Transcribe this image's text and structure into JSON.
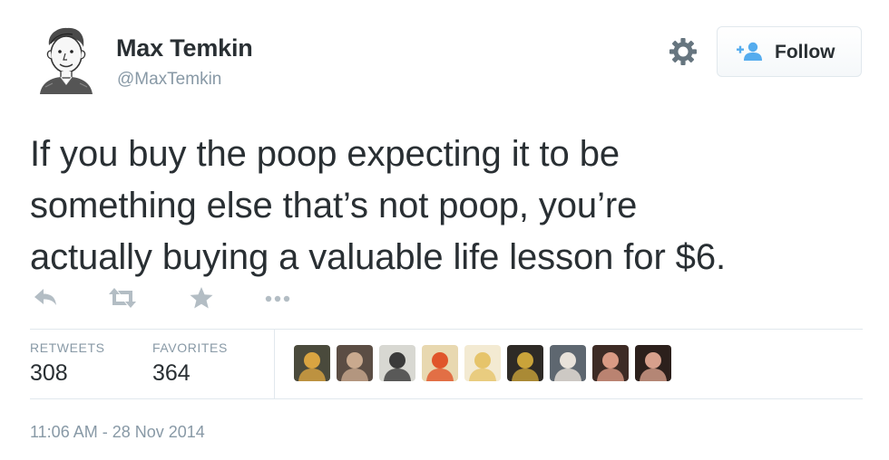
{
  "author": {
    "display_name": "Max Temkin",
    "handle": "@MaxTemkin",
    "avatar_icon": "sketch-portrait-avatar"
  },
  "follow_button": {
    "label": "Follow",
    "icon": "add-user-icon",
    "icon_color": "#55acee"
  },
  "settings_icon": "gear-icon",
  "tweet": {
    "lines": [
      "If you buy the poop expecting it to be",
      "something else that’s not poop, you’re",
      "actually buying a valuable life lesson for $6."
    ]
  },
  "actions": [
    {
      "name": "reply",
      "icon": "reply-icon"
    },
    {
      "name": "retweet",
      "icon": "retweet-icon"
    },
    {
      "name": "favorite",
      "icon": "star-icon"
    },
    {
      "name": "more",
      "icon": "more-dots-icon"
    }
  ],
  "stats": {
    "retweets_label": "RETWEETS",
    "retweets_value": "308",
    "favorites_label": "FAVORITES",
    "favorites_value": "364"
  },
  "favoriters": [
    {
      "icon": "user-avatar-1",
      "bg": "#4a4a3c",
      "fg": "#d9a441"
    },
    {
      "icon": "user-avatar-2",
      "bg": "#5b4d44",
      "fg": "#c9a98e"
    },
    {
      "icon": "user-avatar-3",
      "bg": "#d8d8d2",
      "fg": "#3a3a3a"
    },
    {
      "icon": "user-avatar-4",
      "bg": "#e8d8b0",
      "fg": "#e0552a"
    },
    {
      "icon": "user-avatar-5",
      "bg": "#f3ead2",
      "fg": "#e6c46a"
    },
    {
      "icon": "user-avatar-6",
      "bg": "#2e2a26",
      "fg": "#c9a33a"
    },
    {
      "icon": "user-avatar-7",
      "bg": "#5e6770",
      "fg": "#e8e2da"
    },
    {
      "icon": "user-avatar-8",
      "bg": "#3d2b25",
      "fg": "#d99a84"
    },
    {
      "icon": "user-avatar-9",
      "bg": "#2c201c",
      "fg": "#d7a08c"
    }
  ],
  "timestamp": "11:06 AM - 28 Nov 2014",
  "colors": {
    "text": "#292f33",
    "muted": "#8899a6",
    "border": "#e1e8ed",
    "icon_muted": "#b3bdc4"
  }
}
